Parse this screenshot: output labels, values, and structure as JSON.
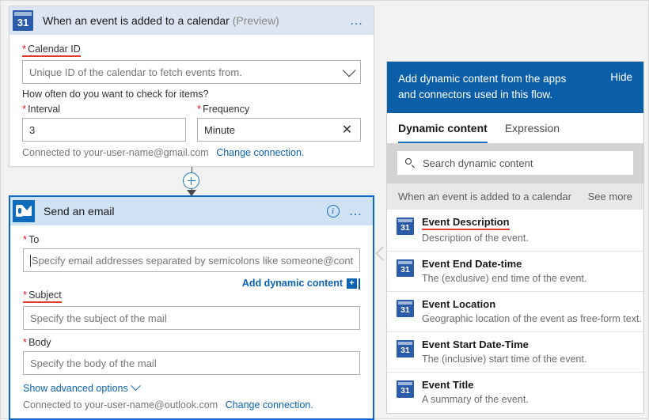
{
  "trigger_card": {
    "icon": "calendar-31-icon",
    "title": "When an event is added to a calendar",
    "preview_tag": "(Preview)",
    "menu_icon": "ellipsis-icon",
    "calendar_id": {
      "label": "Calendar ID",
      "placeholder": "Unique ID of the calendar to fetch events from.",
      "value": "",
      "dropdown_icon": "chevron-down-icon"
    },
    "check_question": "How often do you want to check for items?",
    "interval": {
      "label": "Interval",
      "value": "3"
    },
    "frequency": {
      "label": "Frequency",
      "value": "Minute",
      "clear_icon": "close-icon"
    },
    "connection_text": "Connected to your-user-name@gmail.com",
    "change_connection": "Change connection."
  },
  "connector": {
    "add_icon": "plus-circle-icon",
    "arrow_icon": "arrow-down-icon"
  },
  "action_card": {
    "icon": "outlook-icon",
    "title": "Send an email",
    "info_icon": "info-icon",
    "menu_icon": "ellipsis-icon",
    "to": {
      "label": "To",
      "placeholder": "Specify email addresses separated by semicolons like someone@contoso.com",
      "value": ""
    },
    "add_dynamic_content": {
      "label": "Add dynamic content",
      "badge_icon": "plus-badge-icon"
    },
    "subject": {
      "label": "Subject",
      "placeholder": "Specify the subject of the mail",
      "value": ""
    },
    "body": {
      "label": "Body",
      "placeholder": "Specify the body of the mail",
      "value": ""
    },
    "show_advanced": "Show advanced options",
    "advanced_chevron_icon": "chevron-down-icon",
    "connection_text": "Connected to your-user-name@outlook.com",
    "change_connection": "Change connection."
  },
  "pane_chevron_icon": "chevron-left-icon",
  "dynamic_panel": {
    "header_text": "Add dynamic content from the apps and connectors used in this flow.",
    "hide_label": "Hide",
    "tabs": [
      {
        "label": "Dynamic content",
        "active": true
      },
      {
        "label": "Expression",
        "active": false
      }
    ],
    "search": {
      "placeholder": "Search dynamic content",
      "value": "",
      "icon": "search-icon"
    },
    "group": {
      "title": "When an event is added to a calendar",
      "see_more": "See more"
    },
    "items": [
      {
        "icon": "calendar-31-icon",
        "name": "Event Description",
        "description": "Description of the event.",
        "highlighted": true
      },
      {
        "icon": "calendar-31-icon",
        "name": "Event End Date-time",
        "description": "The (exclusive) end time of the event.",
        "highlighted": false
      },
      {
        "icon": "calendar-31-icon",
        "name": "Event Location",
        "description": "Geographic location of the event as free-form text.",
        "highlighted": false
      },
      {
        "icon": "calendar-31-icon",
        "name": "Event Start Date-Time",
        "description": "The (inclusive) start time of the event.",
        "highlighted": false
      },
      {
        "icon": "calendar-31-icon",
        "name": "Event Title",
        "description": "A summary of the event.",
        "highlighted": false
      }
    ]
  },
  "colors": {
    "accent_blue": "#0a62b5",
    "panel_header_blue": "#0b5ea8",
    "selected_border": "#0a68c6",
    "required_red": "#e81123",
    "highlight_red": "#e23b2e",
    "trigger_header": "#dde5f2",
    "action_header": "#cfe2f3"
  }
}
